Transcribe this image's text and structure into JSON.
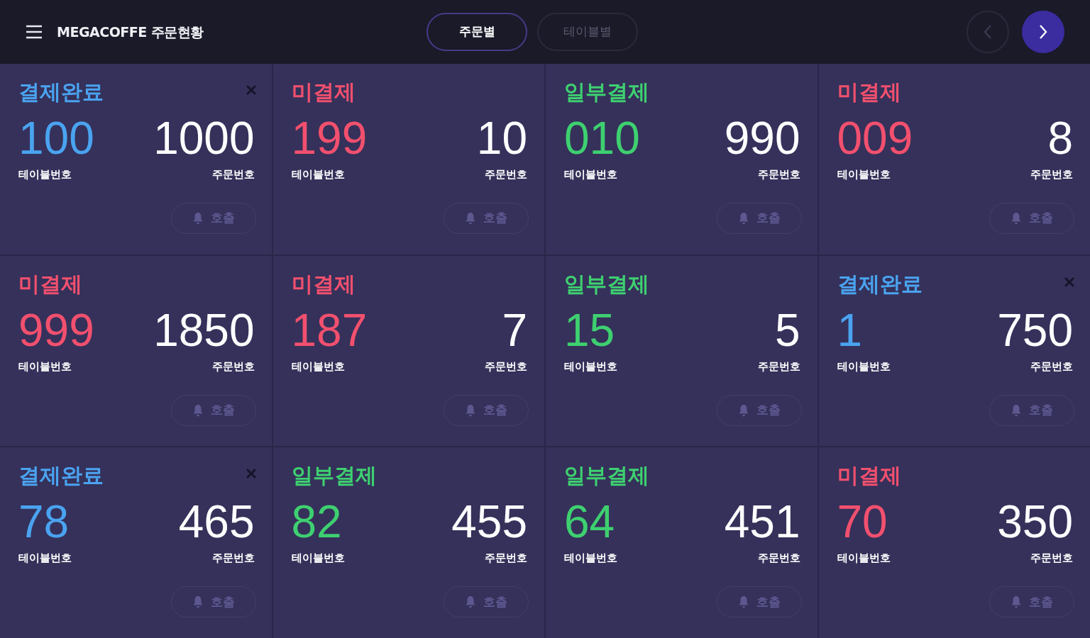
{
  "header": {
    "title": "MEGACOFFE 주문현황",
    "tabs": [
      {
        "label": "주문별",
        "selected": true
      },
      {
        "label": "테이블별",
        "selected": false
      }
    ],
    "prev": {
      "disabled": true
    },
    "next": {
      "disabled": false
    }
  },
  "orders": [
    {
      "kind": "paid",
      "status": "결제완료",
      "table_no": "100",
      "table_label": "테이블번호",
      "order_no": "1000",
      "order_label": "주문번호",
      "call": "호출"
    },
    {
      "kind": "unpaid",
      "status": "미결제",
      "table_no": "199",
      "table_label": "테이블번호",
      "order_no": "10",
      "order_label": "주문번호",
      "call": "호출"
    },
    {
      "kind": "partial",
      "status": "일부결제",
      "table_no": "010",
      "table_label": "테이블번호",
      "order_no": "990",
      "order_label": "주문번호",
      "call": "호출"
    },
    {
      "kind": "unpaid",
      "status": "미결제",
      "table_no": "009",
      "table_label": "테이블번호",
      "order_no": "8",
      "order_label": "주문번호",
      "call": "호출"
    },
    {
      "kind": "unpaid",
      "status": "미결제",
      "table_no": "999",
      "table_label": "테이블번호",
      "order_no": "1850",
      "order_label": "주문번호",
      "call": "호출"
    },
    {
      "kind": "unpaid",
      "status": "미결제",
      "table_no": "187",
      "table_label": "테이블번호",
      "order_no": "7",
      "order_label": "주문번호",
      "call": "호출"
    },
    {
      "kind": "partial",
      "status": "일부결제",
      "table_no": "15",
      "table_label": "테이블번호",
      "order_no": "5",
      "order_label": "주문번호",
      "call": "호출"
    },
    {
      "kind": "paid",
      "status": "결제완료",
      "table_no": "1",
      "table_label": "테이블번호",
      "order_no": "750",
      "order_label": "주문번호",
      "call": "호출"
    },
    {
      "kind": "paid",
      "status": "결제완료",
      "table_no": "78",
      "table_label": "테이블번호",
      "order_no": "465",
      "order_label": "주문번호",
      "call": "호출"
    },
    {
      "kind": "partial",
      "status": "일부결제",
      "table_no": "82",
      "table_label": "테이블번호",
      "order_no": "455",
      "order_label": "주문번호",
      "call": "호출"
    },
    {
      "kind": "partial",
      "status": "일부결제",
      "table_no": "64",
      "table_label": "테이블번호",
      "order_no": "451",
      "order_label": "주문번호",
      "call": "호출"
    },
    {
      "kind": "unpaid",
      "status": "미결제",
      "table_no": "70",
      "table_label": "테이블번호",
      "order_no": "350",
      "order_label": "주문번호",
      "call": "호출"
    }
  ]
}
